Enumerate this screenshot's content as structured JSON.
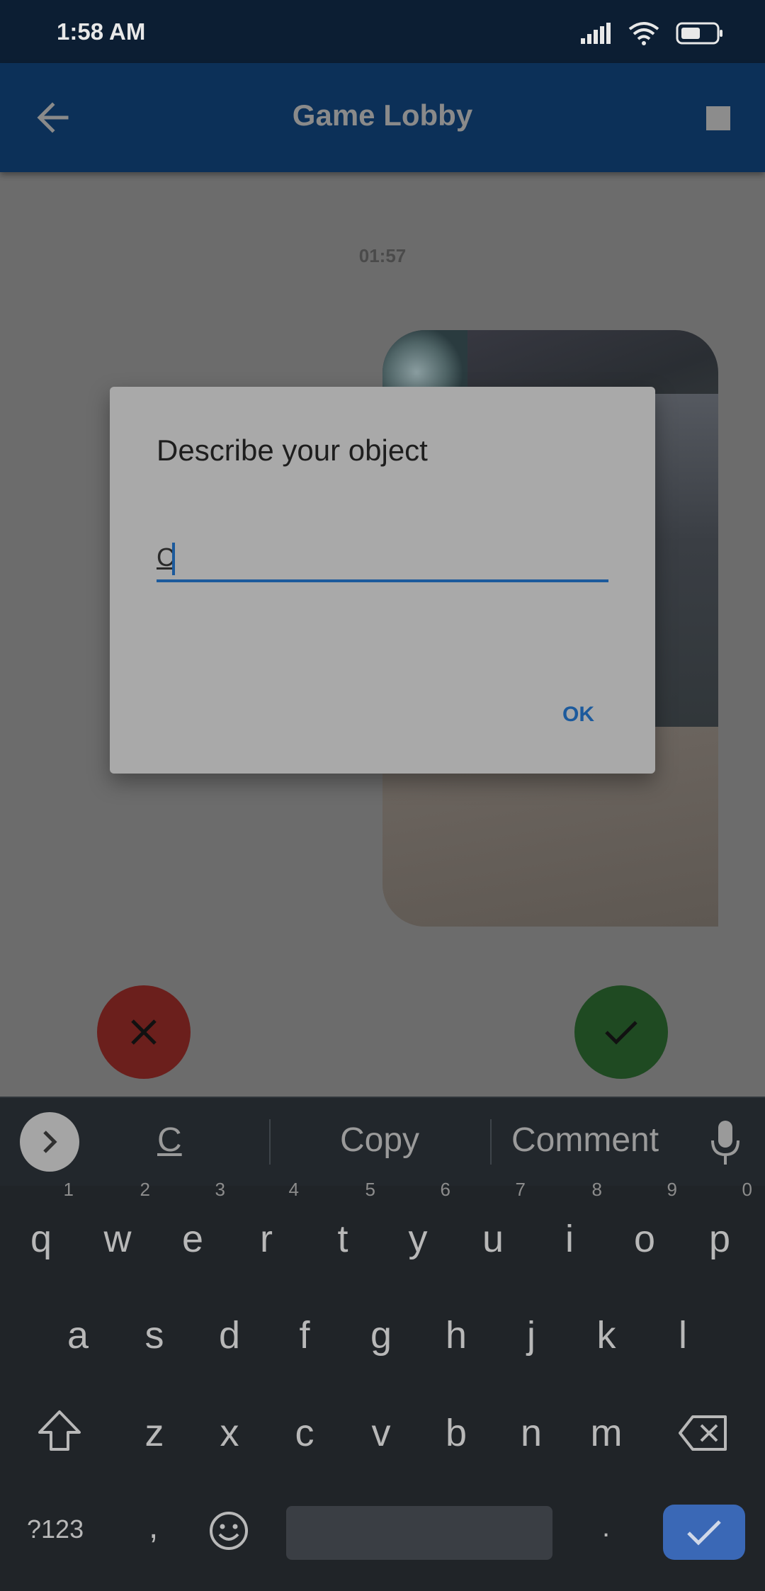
{
  "status_bar": {
    "time": "1:58 AM"
  },
  "app_bar": {
    "title": "Game Lobby"
  },
  "timer": "01:57",
  "dialog": {
    "title": "Describe your object",
    "input_value": "C",
    "ok_label": "OK"
  },
  "keyboard": {
    "suggestions": [
      "C",
      "Copy",
      "Comment"
    ],
    "row1": [
      {
        "k": "q",
        "n": "1"
      },
      {
        "k": "w",
        "n": "2"
      },
      {
        "k": "e",
        "n": "3"
      },
      {
        "k": "r",
        "n": "4"
      },
      {
        "k": "t",
        "n": "5"
      },
      {
        "k": "y",
        "n": "6"
      },
      {
        "k": "u",
        "n": "7"
      },
      {
        "k": "i",
        "n": "8"
      },
      {
        "k": "o",
        "n": "9"
      },
      {
        "k": "p",
        "n": "0"
      }
    ],
    "row2": [
      "a",
      "s",
      "d",
      "f",
      "g",
      "h",
      "j",
      "k",
      "l"
    ],
    "row3": [
      "z",
      "x",
      "c",
      "v",
      "b",
      "n",
      "m"
    ],
    "symbols_label": "?123",
    "comma": ",",
    "period": "."
  },
  "colors": {
    "app_bar": "#0c3058",
    "accent": "#1c5a9c",
    "reject": "#6b1f1c",
    "accept": "#1f4a22",
    "enter_key": "#3a68b6"
  }
}
